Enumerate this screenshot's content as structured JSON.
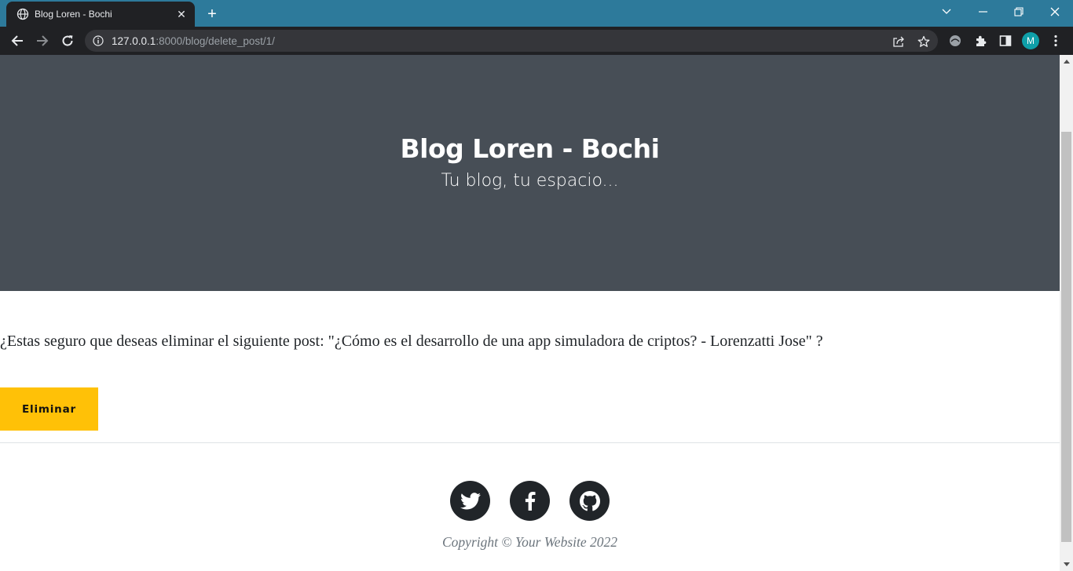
{
  "browser": {
    "tab_title": "Blog Loren - Bochi",
    "url_host": "127.0.0.1",
    "url_rest": ":8000/blog/delete_post/1/",
    "profile_initial": "M",
    "colors": {
      "tabbar": "#2d7a9b",
      "toolbar": "#202124",
      "omnibox": "#35363a",
      "avatar": "#0f9fa8"
    }
  },
  "header": {
    "title": "Blog Loren - Bochi",
    "subtitle": "Tu blog, tu espacio..."
  },
  "main": {
    "confirm_text": "¿Estas seguro que deseas eliminar el siguiente post: \"¿Cómo es el desarrollo de una app simuladora de criptos? - Lorenzatti Jose\" ?",
    "delete_button": "Eliminar"
  },
  "footer": {
    "social": [
      "twitter-icon",
      "facebook-icon",
      "github-icon"
    ],
    "copyright": "Copyright © Your Website 2022"
  },
  "colors": {
    "masthead": "#474e56",
    "button": "#ffc107",
    "social_circle": "#212529",
    "text": "#212529",
    "muted": "#6c757d"
  }
}
